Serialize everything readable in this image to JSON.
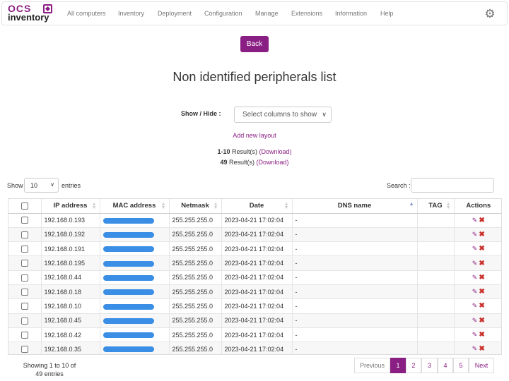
{
  "navbar": {
    "logo_top": "OCS",
    "logo_bottom": "inventory",
    "items": [
      "All computers",
      "Inventory",
      "Deployment",
      "Configuration",
      "Manage",
      "Extensions",
      "Information",
      "Help"
    ]
  },
  "back_label": "Back",
  "title": "Non identified peripherals list",
  "show_hide": {
    "label": "Show / Hide :",
    "select_value": "Select columns to show"
  },
  "add_layout": "Add new layout",
  "results": [
    {
      "count": "1-10",
      "text": " Result(s) ",
      "download": "(Download)"
    },
    {
      "count": "49",
      "text": " Result(s) ",
      "download": "(Download)"
    }
  ],
  "length": {
    "show": "Show",
    "value": "10",
    "entries": "entries"
  },
  "search": {
    "label": "Search :",
    "value": ""
  },
  "table": {
    "columns": [
      "",
      "IP address",
      "MAC address",
      "Netmask",
      "Date",
      "DNS name",
      "TAG",
      "Actions"
    ],
    "rows": [
      {
        "ip": "192.168.0.193",
        "netmask": "255.255.255.0",
        "date": "2023-04-21 17:02:04",
        "dns": "-",
        "tag": ""
      },
      {
        "ip": "192.168.0.192",
        "netmask": "255.255.255.0",
        "date": "2023-04-21 17:02:04",
        "dns": "-",
        "tag": ""
      },
      {
        "ip": "192.168.0.191",
        "netmask": "255.255.255.0",
        "date": "2023-04-21 17:02:04",
        "dns": "-",
        "tag": ""
      },
      {
        "ip": "192.168.0.195",
        "netmask": "255.255.255.0",
        "date": "2023-04-21 17:02:04",
        "dns": "-",
        "tag": ""
      },
      {
        "ip": "192.168.0.44",
        "netmask": "255.255.255.0",
        "date": "2023-04-21 17:02:04",
        "dns": "-",
        "tag": ""
      },
      {
        "ip": "192.168.0.18",
        "netmask": "255.255.255.0",
        "date": "2023-04-21 17:02:04",
        "dns": "-",
        "tag": ""
      },
      {
        "ip": "192.168.0.10",
        "netmask": "255.255.255.0",
        "date": "2023-04-21 17:02:04",
        "dns": "-",
        "tag": ""
      },
      {
        "ip": "192.168.0.45",
        "netmask": "255.255.255.0",
        "date": "2023-04-21 17:02:04",
        "dns": "-",
        "tag": ""
      },
      {
        "ip": "192.168.0.42",
        "netmask": "255.255.255.0",
        "date": "2023-04-21 17:02:04",
        "dns": "-",
        "tag": ""
      },
      {
        "ip": "192.168.0.35",
        "netmask": "255.255.255.0",
        "date": "2023-04-21 17:02:04",
        "dns": "-",
        "tag": ""
      }
    ]
  },
  "footer": {
    "info": "Showing 1 to 10 of 49 entries",
    "pagination": [
      "Previous",
      "1",
      "2",
      "3",
      "4",
      "5",
      "Next"
    ]
  },
  "colors": {
    "accent": "#8a1f83",
    "mac_redaction": "#3a8ee6",
    "delete": "#c9302c"
  },
  "icons": {
    "settings": "gear-icon",
    "edit": "edit-icon",
    "delete": "delete-icon"
  }
}
